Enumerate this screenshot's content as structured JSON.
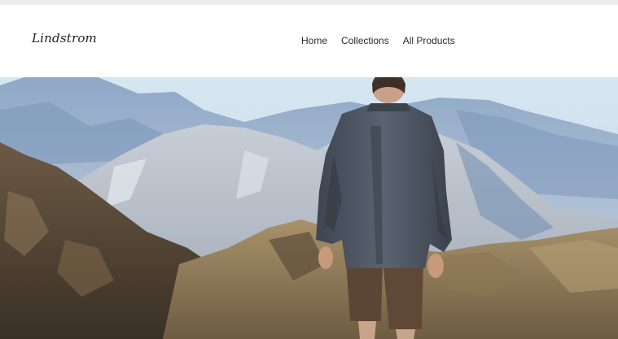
{
  "store": {
    "logo_text": "Lindstrom"
  },
  "nav": {
    "items": [
      {
        "label": "Home"
      },
      {
        "label": "Collections"
      },
      {
        "label": "All Products"
      }
    ]
  },
  "hero": {
    "image_subject": "hiker-in-mountains-photo"
  },
  "colors": {
    "header_bg": "#ffffff",
    "topbar_bg": "#ececec",
    "nav_text": "#2a2a2a",
    "sky": "#cfe0ec",
    "jacket": "#4b5561"
  }
}
